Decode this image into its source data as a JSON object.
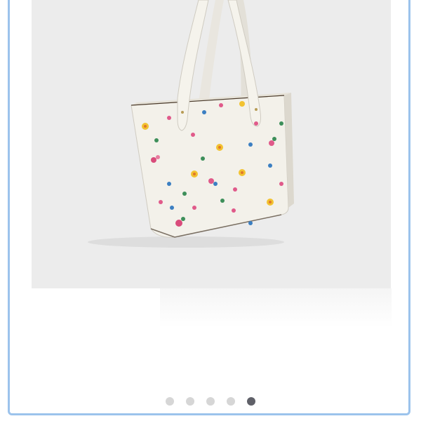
{
  "carousel": {
    "image": {
      "icon": "floral-tote-bag-image",
      "alt": "",
      "background": "#ececec"
    },
    "slides": [
      {
        "active": false
      },
      {
        "active": false
      },
      {
        "active": false
      },
      {
        "active": false
      },
      {
        "active": true
      }
    ],
    "colors": {
      "frame": "#9cc3ec",
      "dot": "#d6d6d6",
      "dot_active": "#5f6068"
    }
  }
}
